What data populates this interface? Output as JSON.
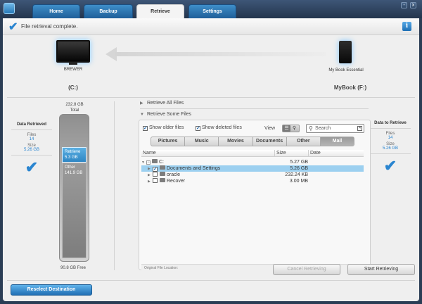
{
  "tabs": [
    "Home",
    "Backup",
    "Retrieve",
    "Settings"
  ],
  "window_controls": {
    "minimize": "-",
    "close": "x"
  },
  "status": {
    "message": "File retrieval complete.",
    "info": "i"
  },
  "devices": {
    "source_name": "BREWER",
    "source_drive": "(C:)",
    "dest_name": "My Book Essential",
    "dest_drive": "MyBook (F:)"
  },
  "capacity": {
    "total_value": "232.8 GB",
    "total_label": "Total",
    "retrieve_label": "Retrieve",
    "retrieve_size": "5.3 GB",
    "other_label": "Other",
    "other_size": "141.9 GB",
    "free": "90.8 GB Free",
    "retrieve_fraction": 0.023,
    "other_fraction": 0.61
  },
  "left_stats": {
    "title": "Data Retrieved",
    "files_label": "Files",
    "files": "14",
    "size_label": "Size",
    "size": "5.26 GB"
  },
  "right_stats": {
    "title": "Data to Retrieve",
    "files_label": "Files",
    "files": "14",
    "size_label": "Size",
    "size": "5.26 GB"
  },
  "retrieve_options": {
    "all": "Retrieve All Files",
    "some": "Retrieve Some Files"
  },
  "browser": {
    "show_older": "Show older files",
    "show_deleted": "Show deleted files",
    "view_label": "View",
    "search_placeholder": "Search",
    "filters": [
      "Pictures",
      "Music",
      "Movies",
      "Documents",
      "Other",
      "Mail"
    ],
    "columns": {
      "name": "Name",
      "size": "Size",
      "date": "Date"
    },
    "rows": [
      {
        "name": "C:",
        "size": "5.27 GB"
      },
      {
        "name": "Documents and Settings",
        "size": "5.26 GB"
      },
      {
        "name": "oracle",
        "size": "232.24 KB"
      },
      {
        "name": "Recover",
        "size": "3.00 MB"
      }
    ],
    "footer": "Original File Location:"
  },
  "buttons": {
    "cancel": "Cancel Retrieving",
    "start": "Start Retrieving",
    "reselect": "Reselect Destination"
  },
  "icons": [
    "app-logo-icon",
    "checkmark-icon",
    "info-icon",
    "monitor-icon",
    "external-drive-icon",
    "arrow-left-icon",
    "folder-icon",
    "search-icon"
  ],
  "colors": {
    "accent": "#2a85d0",
    "tab_blue": "#2e7bbd",
    "selection": "#9cd0f0"
  }
}
